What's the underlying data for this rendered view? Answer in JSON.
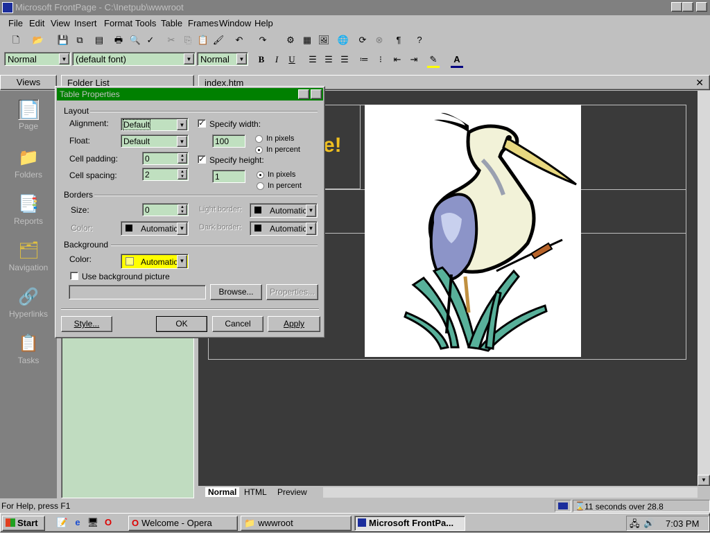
{
  "window": {
    "title": "Microsoft FrontPage - C:\\Inetpub\\wwwroot"
  },
  "menu": [
    "File",
    "Edit",
    "View",
    "Insert",
    "Format",
    "Tools",
    "Table",
    "Frames",
    "Window",
    "Help"
  ],
  "format_bar": {
    "style": "Normal",
    "font": "(default font)",
    "size": "Normal"
  },
  "views": {
    "header": "Views",
    "items": [
      "Page",
      "Folders",
      "Reports",
      "Navigation",
      "Hyperlinks",
      "Tasks"
    ]
  },
  "folder_list": {
    "header": "Folder List"
  },
  "editor": {
    "tab_title": "index.htm",
    "exclaim": "e!",
    "tabs": [
      "Normal",
      "HTML",
      "Preview"
    ]
  },
  "dialog": {
    "title": "Table Properties",
    "layout": {
      "label": "Layout",
      "alignment_label": "Alignment:",
      "alignment_value": "Default",
      "float_label": "Float:",
      "float_value": "Default",
      "cell_padding_label": "Cell padding:",
      "cell_padding_value": "0",
      "cell_spacing_label": "Cell spacing:",
      "cell_spacing_value": "2",
      "specify_width_label": "Specify width:",
      "width_value": "100",
      "width_pixels": "In pixels",
      "width_percent": "In percent",
      "specify_height_label": "Specify height:",
      "height_value": "1",
      "height_pixels": "In pixels",
      "height_percent": "In percent"
    },
    "borders": {
      "label": "Borders",
      "size_label": "Size:",
      "size_value": "0",
      "color_label": "Color:",
      "color_value": "Automatic",
      "light_border_label": "Light border:",
      "light_border_value": "Automatic",
      "dark_border_label": "Dark border:",
      "dark_border_value": "Automatic"
    },
    "background": {
      "label": "Background",
      "color_label": "Color:",
      "color_value": "Automatic",
      "use_picture_label": "Use background picture",
      "browse_label": "Browse...",
      "properties_label": "Properties..."
    },
    "buttons": {
      "style": "Style...",
      "ok": "OK",
      "cancel": "Cancel",
      "apply": "Apply"
    }
  },
  "statusbar": {
    "help": "For Help, press F1",
    "timing": "11 seconds over 28.8"
  },
  "taskbar": {
    "start": "Start",
    "tasks": [
      "Welcome - Opera",
      "wwwroot",
      "Microsoft FrontPa..."
    ],
    "clock": "7:03 PM"
  },
  "colors": {
    "title_inactive": "#808080",
    "dialog_title": "#008000",
    "field_bg": "#c0e0c0",
    "bg_yellow": "#ffff00"
  }
}
